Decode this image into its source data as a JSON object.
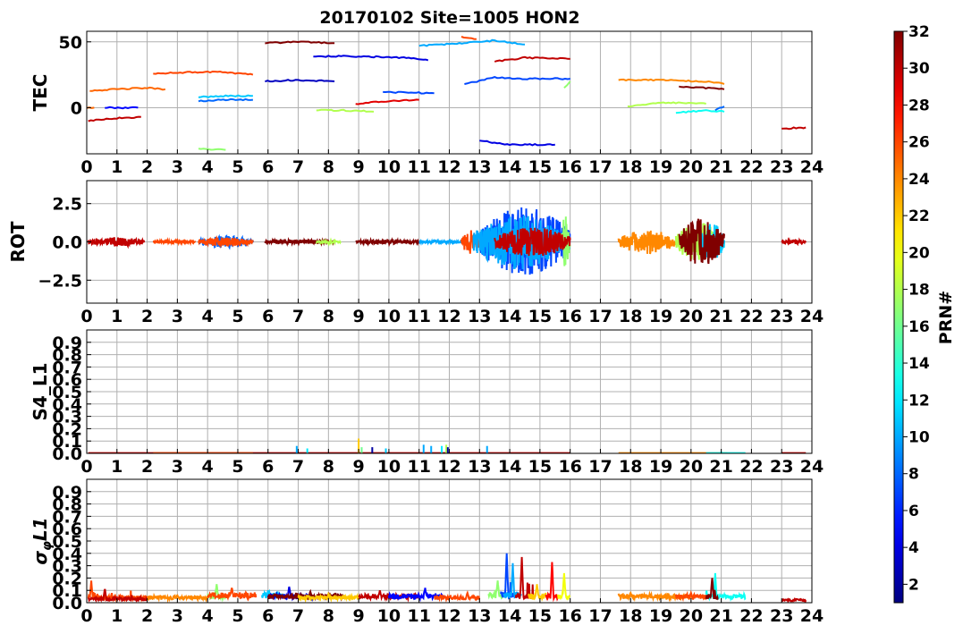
{
  "figure": {
    "title": "20170102 Site=1005 HON2",
    "colorbar": {
      "label": "PRN#",
      "ticks": [
        "2",
        "4",
        "6",
        "8",
        "10",
        "12",
        "14",
        "16",
        "18",
        "20",
        "22",
        "24",
        "26",
        "28",
        "30",
        "32"
      ],
      "range": [
        1,
        32
      ],
      "colormap": "jet"
    }
  },
  "chart_data": [
    {
      "type": "line",
      "ylabel": "TEC",
      "xlabel": "",
      "xlim": [
        0,
        24
      ],
      "ylim": [
        -35,
        58
      ],
      "x_ticks": [
        "0",
        "1",
        "2",
        "3",
        "4",
        "5",
        "6",
        "7",
        "8",
        "9",
        "10",
        "11",
        "12",
        "13",
        "14",
        "15",
        "16",
        "17",
        "18",
        "19",
        "20",
        "21",
        "22",
        "23",
        "24"
      ],
      "y_ticks": [
        "0",
        "50"
      ],
      "grid": true,
      "series": [
        {
          "prn": 25,
          "x": [
            0,
            0.25
          ],
          "y": [
            0,
            0
          ]
        },
        {
          "prn": 25,
          "x": [
            0.1,
            1.0,
            2.0,
            2.6
          ],
          "y": [
            13,
            14,
            15,
            14
          ]
        },
        {
          "prn": 5,
          "x": [
            0.6,
            1.7
          ],
          "y": [
            0,
            0
          ]
        },
        {
          "prn": 30,
          "x": [
            0.05,
            1.0,
            1.8
          ],
          "y": [
            -10,
            -8,
            -7
          ]
        },
        {
          "prn": 26,
          "x": [
            2.2,
            3.5,
            4.5,
            5.5
          ],
          "y": [
            26,
            27,
            27,
            25
          ]
        },
        {
          "prn": 11,
          "x": [
            3.7,
            4.6,
            5.5
          ],
          "y": [
            8,
            9,
            9
          ]
        },
        {
          "prn": 8,
          "x": [
            3.7,
            4.6,
            5.5
          ],
          "y": [
            5,
            6,
            6
          ]
        },
        {
          "prn": 17,
          "x": [
            3.7,
            4.6
          ],
          "y": [
            -31,
            -32
          ]
        },
        {
          "prn": 32,
          "x": [
            5.9,
            7.0,
            8.2
          ],
          "y": [
            49,
            50,
            49
          ]
        },
        {
          "prn": 3,
          "x": [
            5.9,
            7.0,
            8.2
          ],
          "y": [
            20,
            21,
            20
          ]
        },
        {
          "prn": 4,
          "x": [
            7.5,
            9.0,
            10.5,
            11.3
          ],
          "y": [
            39,
            39,
            38,
            36
          ]
        },
        {
          "prn": 18,
          "x": [
            7.6,
            8.5,
            9.5
          ],
          "y": [
            -2,
            -2,
            -3
          ]
        },
        {
          "prn": 29,
          "x": [
            8.9,
            10.0,
            11.0
          ],
          "y": [
            3,
            5,
            6
          ]
        },
        {
          "prn": 7,
          "x": [
            9.8,
            11.5
          ],
          "y": [
            12,
            11
          ]
        },
        {
          "prn": 10,
          "x": [
            11.0,
            12.5,
            13.5,
            14.5
          ],
          "y": [
            47,
            49,
            51,
            48
          ]
        },
        {
          "prn": 26,
          "x": [
            12.4,
            12.9
          ],
          "y": [
            54,
            52
          ]
        },
        {
          "prn": 7,
          "x": [
            12.5,
            13.5,
            14.5,
            16.0
          ],
          "y": [
            18,
            23,
            22,
            22
          ]
        },
        {
          "prn": 30,
          "x": [
            13.5,
            14.5,
            16.0
          ],
          "y": [
            35,
            38,
            37
          ]
        },
        {
          "prn": 17,
          "x": [
            15.8,
            16.0
          ],
          "y": [
            15,
            20
          ]
        },
        {
          "prn": 4,
          "x": [
            13.0,
            14.0,
            15.5
          ],
          "y": [
            -25,
            -28,
            -28
          ]
        },
        {
          "prn": 24,
          "x": [
            17.6,
            19.0,
            20.5,
            21.1
          ],
          "y": [
            21,
            21,
            20,
            18
          ]
        },
        {
          "prn": 18,
          "x": [
            17.9,
            19.0,
            20.5
          ],
          "y": [
            1,
            4,
            3
          ]
        },
        {
          "prn": 13,
          "x": [
            19.5,
            20.5,
            21.1
          ],
          "y": [
            -4,
            -2,
            -3
          ]
        },
        {
          "prn": 8,
          "x": [
            20.8,
            21.1
          ],
          "y": [
            -2,
            1
          ]
        },
        {
          "prn": 32,
          "x": [
            19.6,
            20.4,
            21.1
          ],
          "y": [
            16,
            15,
            14
          ]
        },
        {
          "prn": 30,
          "x": [
            23.0,
            23.8
          ],
          "y": [
            -16,
            -15
          ]
        }
      ]
    },
    {
      "type": "line",
      "ylabel": "ROT",
      "xlabel": "",
      "xlim": [
        0,
        24
      ],
      "ylim": [
        -4,
        4
      ],
      "x_ticks": [
        "0",
        "1",
        "2",
        "3",
        "4",
        "5",
        "6",
        "7",
        "8",
        "9",
        "10",
        "11",
        "12",
        "13",
        "14",
        "15",
        "16",
        "17",
        "18",
        "19",
        "20",
        "21",
        "22",
        "23",
        "24"
      ],
      "y_ticks": [
        "2.5",
        "0.0",
        "−2.5"
      ],
      "grid": true,
      "segments": [
        {
          "prn": 30,
          "start": 0.05,
          "end": 1.9,
          "amp": 0.3
        },
        {
          "prn": 26,
          "start": 2.2,
          "end": 3.6,
          "amp": 0.1
        },
        {
          "prn": 8,
          "start": 3.7,
          "end": 5.5,
          "amp": 0.4
        },
        {
          "prn": 26,
          "start": 3.7,
          "end": 5.5,
          "amp": 0.3
        },
        {
          "prn": 32,
          "start": 5.9,
          "end": 8.2,
          "amp": 0.15
        },
        {
          "prn": 18,
          "start": 7.6,
          "end": 8.4,
          "amp": 0.1
        },
        {
          "prn": 32,
          "start": 8.9,
          "end": 11.0,
          "amp": 0.15
        },
        {
          "prn": 10,
          "start": 11.0,
          "end": 12.5,
          "amp": 0.1
        },
        {
          "prn": 26,
          "start": 12.4,
          "end": 13.0,
          "amp": 0.8
        },
        {
          "prn": 7,
          "start": 13.0,
          "end": 16.0,
          "amp": 2.3
        },
        {
          "prn": 10,
          "start": 12.8,
          "end": 15.8,
          "amp": 1.8
        },
        {
          "prn": 17,
          "start": 15.7,
          "end": 16.0,
          "amp": 1.8
        },
        {
          "prn": 30,
          "start": 13.5,
          "end": 16.0,
          "amp": 1.0
        },
        {
          "prn": 24,
          "start": 17.6,
          "end": 19.5,
          "amp": 0.8
        },
        {
          "prn": 18,
          "start": 19.5,
          "end": 21.0,
          "amp": 1.3
        },
        {
          "prn": 11,
          "start": 20.3,
          "end": 21.1,
          "amp": 1.2
        },
        {
          "prn": 32,
          "start": 19.6,
          "end": 21.1,
          "amp": 1.6
        },
        {
          "prn": 30,
          "start": 23.0,
          "end": 23.8,
          "amp": 0.15
        }
      ]
    },
    {
      "type": "line",
      "ylabel": "S4_L1",
      "xlabel": "",
      "xlim": [
        0,
        24
      ],
      "ylim": [
        0,
        1
      ],
      "x_ticks": [
        "0",
        "1",
        "2",
        "3",
        "4",
        "5",
        "6",
        "7",
        "8",
        "9",
        "10",
        "11",
        "12",
        "13",
        "14",
        "15",
        "16",
        "17",
        "18",
        "19",
        "20",
        "21",
        "22",
        "23",
        "24"
      ],
      "y_ticks": [
        "0.0",
        "0.1",
        "0.2",
        "0.3",
        "0.4",
        "0.5",
        "0.6",
        "0.7",
        "0.8",
        "0.9"
      ],
      "grid": true,
      "baseline": [
        {
          "prn": 30,
          "start": 0.05,
          "end": 16.0
        },
        {
          "prn": 26,
          "start": 2.2,
          "end": 5.5
        },
        {
          "prn": 24,
          "start": 17.6,
          "end": 21.2
        },
        {
          "prn": 13,
          "start": 20.5,
          "end": 21.8
        },
        {
          "prn": 30,
          "start": 23.0,
          "end": 23.8
        }
      ],
      "spikes": [
        {
          "prn": 10,
          "x": 6.95,
          "y": 0.06
        },
        {
          "prn": 12,
          "x": 7.3,
          "y": 0.04
        },
        {
          "prn": 22,
          "x": 9.0,
          "y": 0.12
        },
        {
          "prn": 16,
          "x": 9.1,
          "y": 0.05
        },
        {
          "prn": 2,
          "x": 9.45,
          "y": 0.05
        },
        {
          "prn": 11,
          "x": 9.9,
          "y": 0.04
        },
        {
          "prn": 10,
          "x": 11.15,
          "y": 0.07
        },
        {
          "prn": 10,
          "x": 11.4,
          "y": 0.06
        },
        {
          "prn": 12,
          "x": 11.75,
          "y": 0.06
        },
        {
          "prn": 18,
          "x": 11.9,
          "y": 0.07
        },
        {
          "prn": 2,
          "x": 11.95,
          "y": 0.05
        },
        {
          "prn": 10,
          "x": 13.25,
          "y": 0.06
        },
        {
          "prn": 13,
          "x": 21.0,
          "y": 0.015
        }
      ]
    },
    {
      "type": "line",
      "ylabel": "σφL1",
      "xlabel": "",
      "xlim": [
        0,
        24
      ],
      "ylim": [
        0,
        1
      ],
      "x_ticks": [
        "0",
        "1",
        "2",
        "3",
        "4",
        "5",
        "6",
        "7",
        "8",
        "9",
        "10",
        "11",
        "12",
        "13",
        "14",
        "15",
        "16",
        "17",
        "18",
        "19",
        "20",
        "21",
        "22",
        "23",
        "24"
      ],
      "y_ticks": [
        "0.0",
        "0.1",
        "0.2",
        "0.3",
        "0.4",
        "0.5",
        "0.6",
        "0.7",
        "0.8",
        "0.9"
      ],
      "grid": true,
      "segments": [
        {
          "prn": 26,
          "start": 0.05,
          "end": 2.0,
          "base": 0.04,
          "peak": 0.18,
          "peak_x": 0.15
        },
        {
          "prn": 30,
          "start": 0.05,
          "end": 2.0,
          "base": 0.03,
          "peak": 0.12,
          "peak_x": 0.6
        },
        {
          "prn": 24,
          "start": 2.0,
          "end": 4.0,
          "base": 0.04,
          "peak": 0.06,
          "peak_x": 3.0
        },
        {
          "prn": 17,
          "start": 4.0,
          "end": 4.6,
          "base": 0.05,
          "peak": 0.15,
          "peak_x": 4.3
        },
        {
          "prn": 26,
          "start": 4.0,
          "end": 5.6,
          "base": 0.06,
          "peak": 0.12,
          "peak_x": 4.8
        },
        {
          "prn": 11,
          "start": 5.8,
          "end": 6.5,
          "base": 0.06,
          "peak": 0.1,
          "peak_x": 6.0
        },
        {
          "prn": 4,
          "start": 6.0,
          "end": 7.5,
          "base": 0.05,
          "peak": 0.13,
          "peak_x": 6.7
        },
        {
          "prn": 32,
          "start": 6.0,
          "end": 8.5,
          "base": 0.05,
          "peak": 0.09,
          "peak_x": 7.4
        },
        {
          "prn": 22,
          "start": 7.0,
          "end": 9.0,
          "base": 0.04,
          "peak": 0.07,
          "peak_x": 8.0
        },
        {
          "prn": 30,
          "start": 9.0,
          "end": 11.0,
          "base": 0.05,
          "peak": 0.1,
          "peak_x": 9.7
        },
        {
          "prn": 5,
          "start": 10.0,
          "end": 11.8,
          "base": 0.05,
          "peak": 0.12,
          "peak_x": 11.2
        },
        {
          "prn": 26,
          "start": 11.5,
          "end": 13.0,
          "base": 0.04,
          "peak": 0.08,
          "peak_x": 12.6
        },
        {
          "prn": 17,
          "start": 13.3,
          "end": 13.8,
          "base": 0.06,
          "peak": 0.18,
          "peak_x": 13.6
        },
        {
          "prn": 7,
          "start": 13.7,
          "end": 14.2,
          "base": 0.06,
          "peak": 0.4,
          "peak_x": 13.9
        },
        {
          "prn": 10,
          "start": 13.8,
          "end": 14.4,
          "base": 0.06,
          "peak": 0.32,
          "peak_x": 14.1
        },
        {
          "prn": 30,
          "start": 14.2,
          "end": 14.8,
          "base": 0.05,
          "peak": 0.37,
          "peak_x": 14.4
        },
        {
          "prn": 22,
          "start": 14.6,
          "end": 15.2,
          "base": 0.05,
          "peak": 0.15,
          "peak_x": 14.9
        },
        {
          "prn": 28,
          "start": 15.2,
          "end": 15.6,
          "base": 0.05,
          "peak": 0.33,
          "peak_x": 15.4
        },
        {
          "prn": 20,
          "start": 15.6,
          "end": 16.0,
          "base": 0.05,
          "peak": 0.24,
          "peak_x": 15.8
        },
        {
          "prn": 24,
          "start": 17.6,
          "end": 20.0,
          "base": 0.05,
          "peak": 0.08,
          "peak_x": 18.0
        },
        {
          "prn": 26,
          "start": 19.5,
          "end": 20.5,
          "base": 0.05,
          "peak": 0.08,
          "peak_x": 20.0
        },
        {
          "prn": 13,
          "start": 20.5,
          "end": 21.8,
          "base": 0.05,
          "peak": 0.24,
          "peak_x": 20.8
        },
        {
          "prn": 32,
          "start": 20.5,
          "end": 20.9,
          "base": 0.05,
          "peak": 0.2,
          "peak_x": 20.7
        },
        {
          "prn": 30,
          "start": 23.0,
          "end": 23.8,
          "base": 0.02,
          "peak": 0.03,
          "peak_x": 23.5
        }
      ]
    }
  ]
}
